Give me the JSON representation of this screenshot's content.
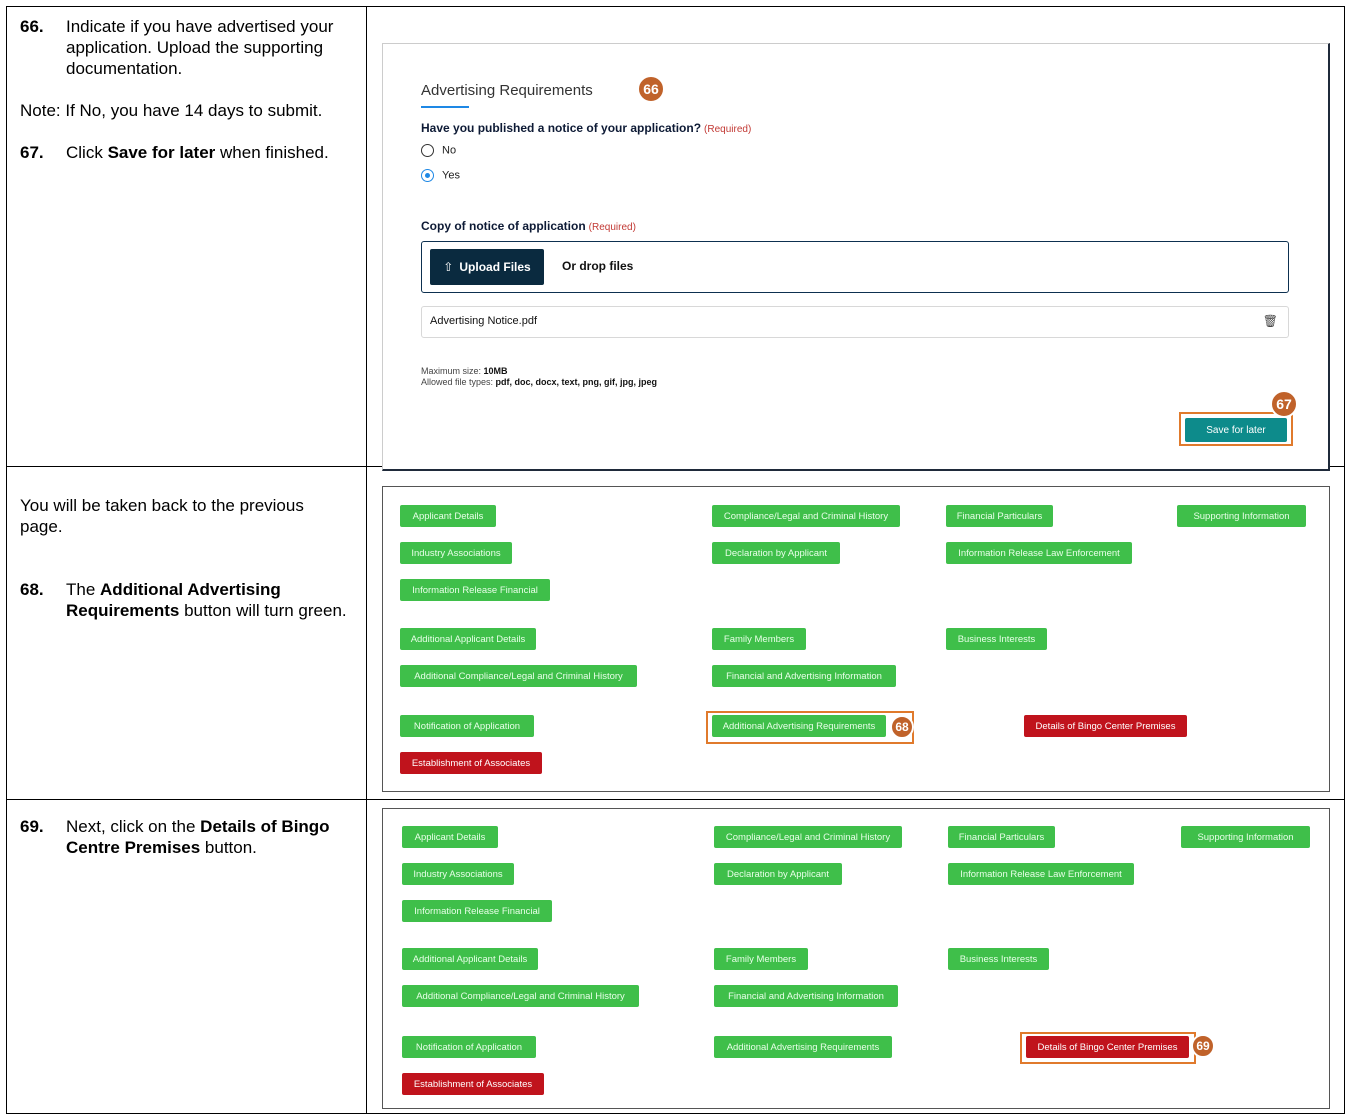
{
  "instructions": {
    "row1": {
      "step66_num": "66.",
      "step66_text": "Indicate if you have advertised your application. Upload the supporting documentation.",
      "note": "Note: If No, you have 14 days to submit.",
      "step67_num": "67.",
      "step67_pre": "Click ",
      "step67_bold": "Save for later",
      "step67_post": " when finished."
    },
    "row2": {
      "intro": "You will be taken back to the previous page.",
      "step68_num": "68.",
      "step68_pre": "The ",
      "step68_bold": "Additional Advertising Requirements",
      "step68_post": " button will turn green."
    },
    "row3": {
      "step69_num": "69.",
      "step69_pre": "Next, click on the ",
      "step69_bold": "Details of Bingo Centre Premises",
      "step69_post": " button."
    }
  },
  "form": {
    "tab_label": "Advertising Requirements",
    "question1": "Have you published a notice of your application?",
    "required_label": "(Required)",
    "radio_options": [
      "No",
      "Yes"
    ],
    "selected_option": "Yes",
    "question2": "Copy of notice of application",
    "upload_button": "Upload Files",
    "upload_icon": "upload-icon",
    "drop_text": "Or drop files",
    "file_name": "Advertising Notice.pdf",
    "trash_icon": "trash-icon",
    "max_size_label": "Maximum size: ",
    "max_size_value": "10MB",
    "file_types_label": "Allowed file types: ",
    "file_types_value": "pdf, doc, docx, text, png, gif, jpg, jpeg",
    "save_button": "Save for later"
  },
  "badges": {
    "b66": "66",
    "b67": "67",
    "b68": "68",
    "b69": "69"
  },
  "panel_buttons": {
    "applicant_details": "Applicant Details",
    "compliance": "Compliance/Legal and Criminal History",
    "financial_particulars": "Financial Particulars",
    "supporting_information": "Supporting Information",
    "industry_associations": "Industry Associations",
    "declaration": "Declaration by Applicant",
    "info_release_law": "Information Release Law Enforcement",
    "info_release_financial": "Information Release Financial",
    "additional_applicant": "Additional Applicant Details",
    "family_members": "Family Members",
    "business_interests": "Business Interests",
    "additional_compliance": "Additional Compliance/Legal and Criminal History",
    "financial_advertising": "Financial and Advertising Information",
    "notification": "Notification of Application",
    "additional_advertising": "Additional Advertising Requirements",
    "bingo_premises": "Details of Bingo Center Premises",
    "establishment": "Establishment of Associates"
  },
  "colors": {
    "green": "#3fbf4a",
    "red": "#c0131c",
    "highlight": "#e07a2c",
    "badge": "#c0622a",
    "teal": "#0d8b8b"
  }
}
